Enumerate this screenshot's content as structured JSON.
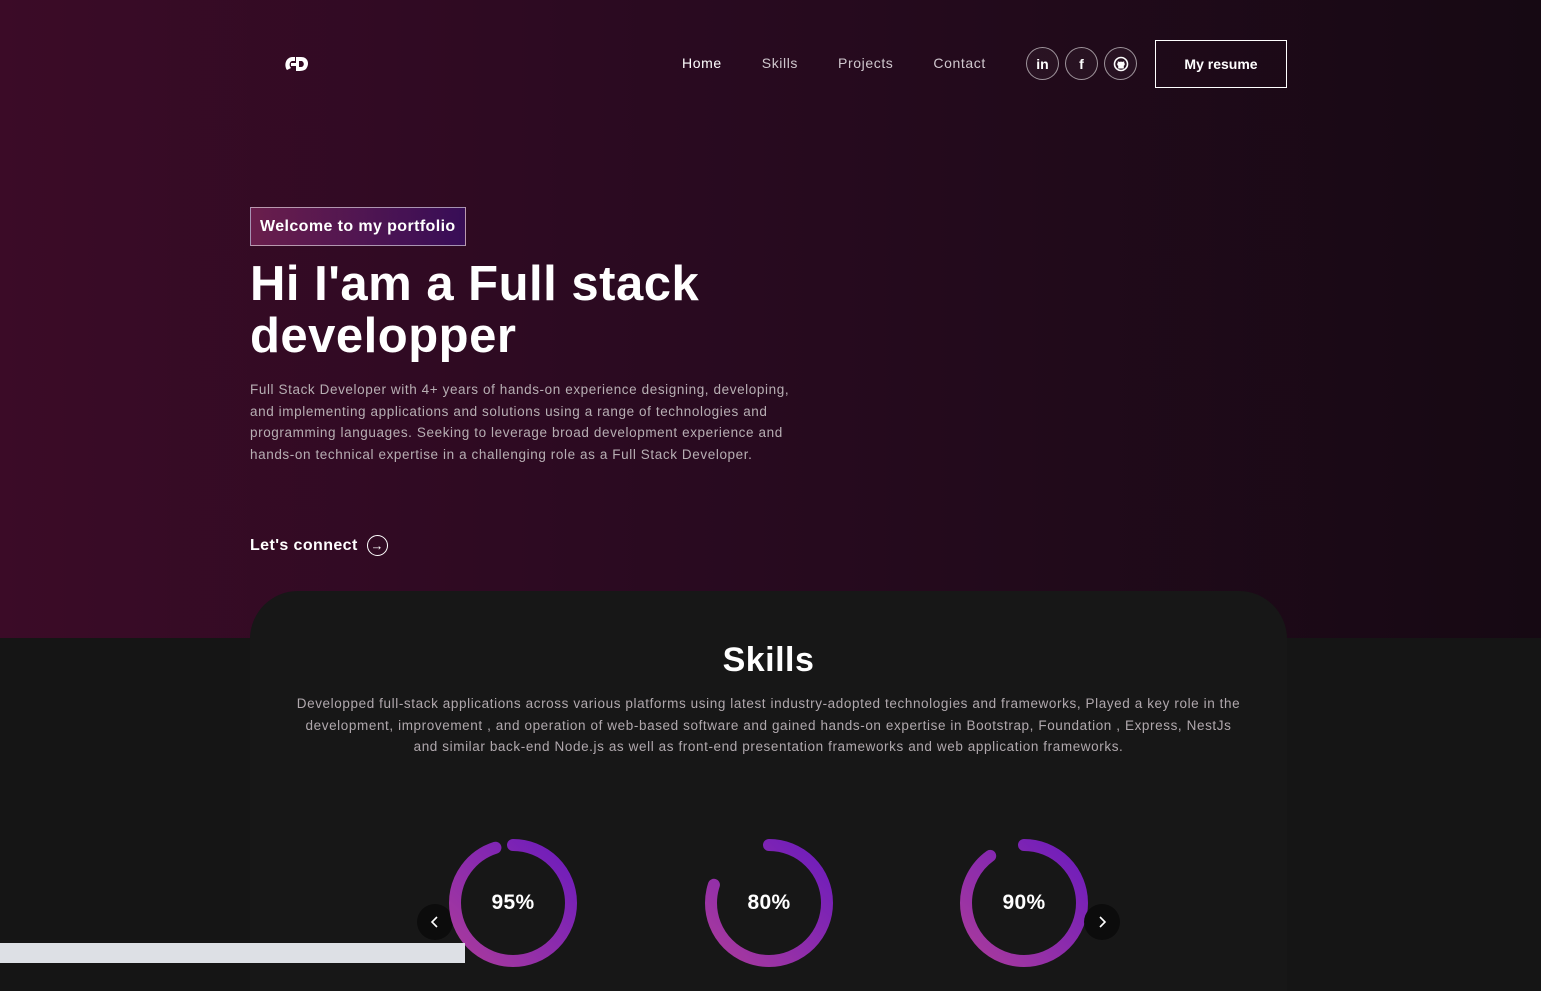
{
  "nav": {
    "links": [
      {
        "label": "Home"
      },
      {
        "label": "Skills"
      },
      {
        "label": "Projects"
      },
      {
        "label": "Contact"
      }
    ],
    "socials": [
      {
        "icon": "linkedin-icon",
        "glyph": "in"
      },
      {
        "icon": "facebook-icon",
        "glyph": "f"
      },
      {
        "icon": "github-icon",
        "glyph": ""
      }
    ],
    "resume_label": "My resume"
  },
  "hero": {
    "badge": "Welcome to my portfolio",
    "title": "Hi I'am a Full stack developper",
    "description": "Full Stack Developer with 4+ years of hands-on experience designing, developing, and implementing applications and solutions using a range of technologies and programming languages. Seeking to leverage broad development experience and hands-on technical expertise in a challenging role as a Full Stack Developer.",
    "connect_label": "Let's connect"
  },
  "skills": {
    "title": "Skills",
    "description": "Developped full-stack applications across various platforms using latest industry-adopted technologies and frameworks, Played a key role in the development, improvement , and operation of web-based software and gained hands-on expertise in Bootstrap, Foundation , Express, NestJs and similar back-end Node.js as well as front-end presentation frameworks and web application frameworks.",
    "items": [
      {
        "percent": 95,
        "label": "95%"
      },
      {
        "percent": 80,
        "label": "80%"
      },
      {
        "percent": 90,
        "label": "90%"
      }
    ]
  },
  "colors": {
    "ring_start": "#aa3b9c",
    "ring_end": "#6c1bbd",
    "hero_bg": "#3b0b27",
    "card_bg": "#171717"
  }
}
